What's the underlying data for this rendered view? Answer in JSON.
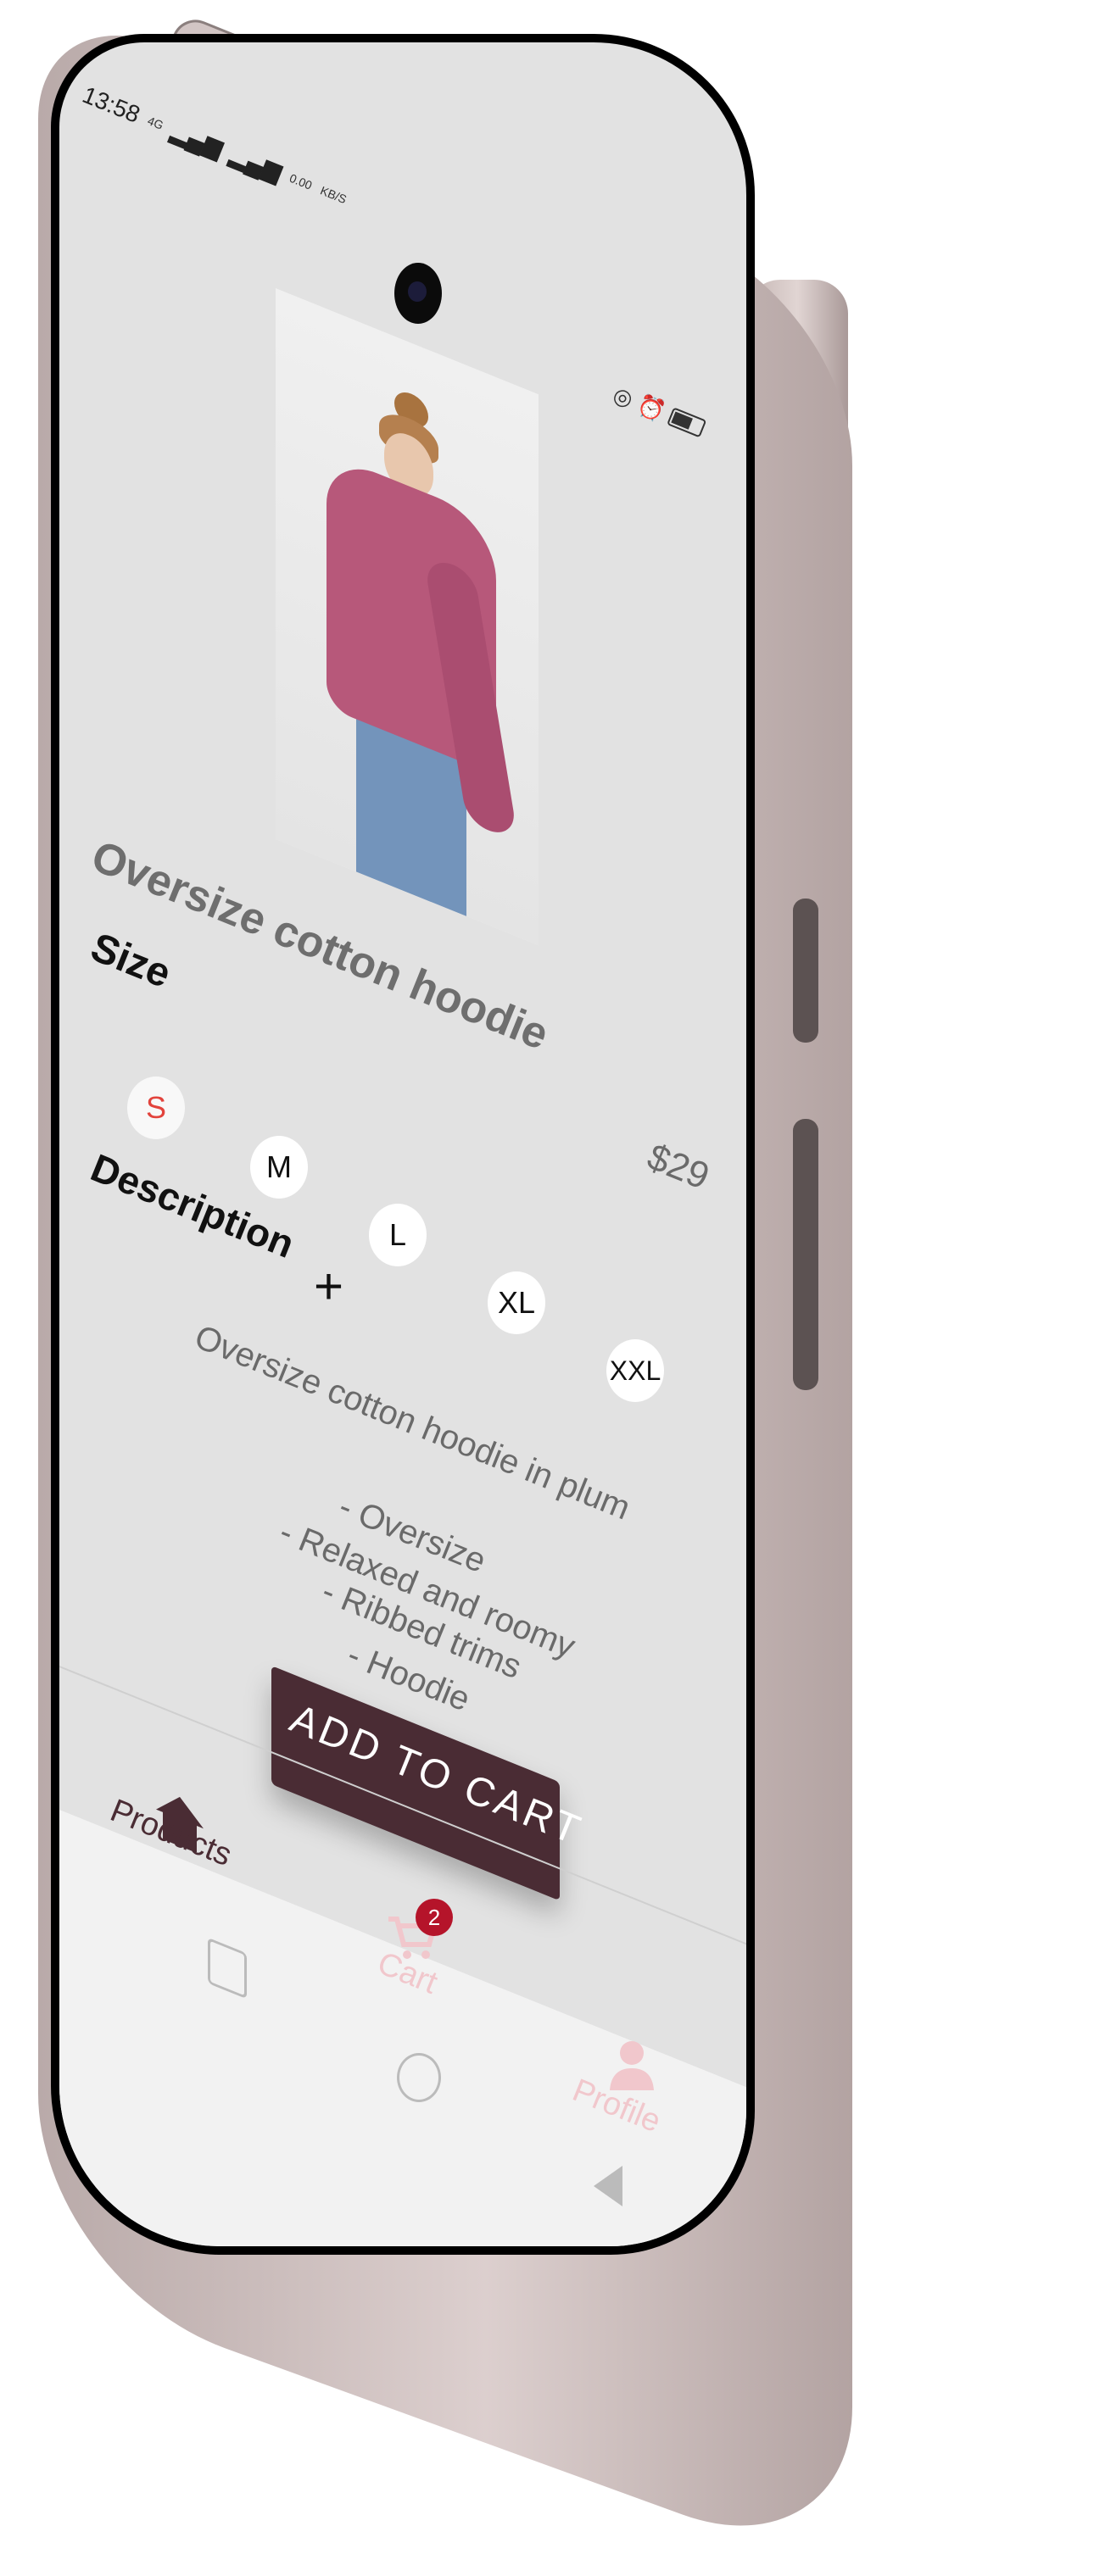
{
  "status_bar": {
    "time": "13:58",
    "network": "4G",
    "speed": "0.00",
    "speed_unit": "KB/S"
  },
  "product": {
    "title": "Oversize cotton hoodie",
    "price": "$29",
    "size_label": "Size",
    "sizes": [
      "S",
      "M",
      "L",
      "XL",
      "XXL"
    ],
    "selected_size": "S",
    "description_label": "Description",
    "expand_symbol": "+",
    "description": "Oversize cotton hoodie in plum",
    "features": [
      "- Oversize",
      "- Relaxed and roomy",
      "- Ribbed trims",
      "- Hoodie"
    ],
    "add_to_cart_label": "ADD TO CART"
  },
  "bottom_nav": {
    "items": [
      {
        "label": "Products",
        "icon": "home-icon",
        "active": true
      },
      {
        "label": "Cart",
        "icon": "cart-icon",
        "active": false
      },
      {
        "label": "Profile",
        "icon": "person-icon",
        "active": false
      }
    ],
    "cart_badge": "2"
  },
  "colors": {
    "accent": "#4a2c34",
    "selected_size": "#e2433c",
    "badge": "#b5142a",
    "screen_bg": "#e2e2e2"
  }
}
